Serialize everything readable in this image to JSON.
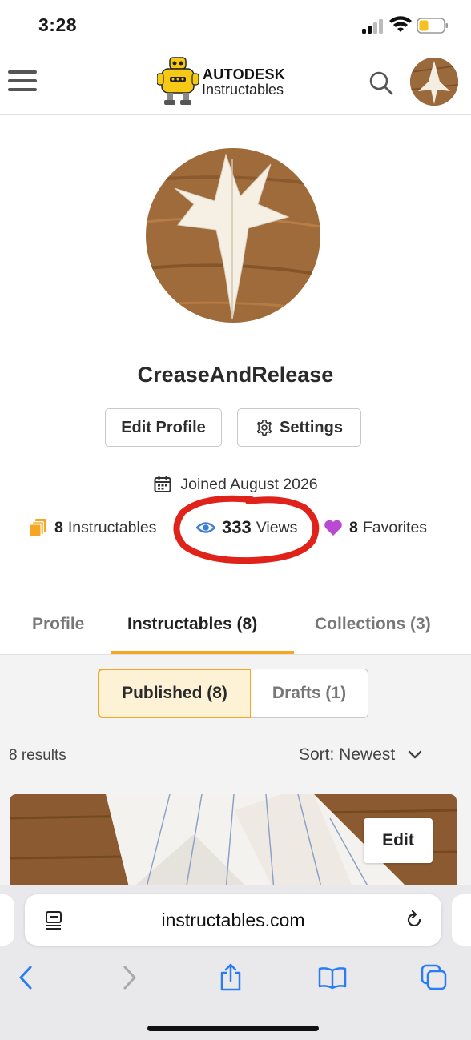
{
  "status_bar": {
    "time": "3:28"
  },
  "header": {
    "logo_brand": "AUTODESK",
    "logo_sub": "Instructables",
    "icons": [
      "hamburger-menu-icon",
      "search-icon",
      "user-avatar"
    ]
  },
  "profile": {
    "username": "CreaseAndRelease",
    "edit_profile_label": "Edit Profile",
    "settings_label": "Settings",
    "joined": "Joined August 2026",
    "stats": {
      "instructables_count": "8",
      "instructables_label": "Instructables",
      "views_count": "333",
      "views_label": "Views",
      "favorites_count": "8",
      "favorites_label": "Favorites"
    }
  },
  "tabs": [
    {
      "label": "Profile",
      "active": false
    },
    {
      "label": "Instructables (8)",
      "active": true
    },
    {
      "label": "Collections (3)",
      "active": false
    }
  ],
  "filters": {
    "published_label": "Published (8)",
    "drafts_label": "Drafts (1)"
  },
  "results": {
    "count_text": "8 results",
    "sort_label": "Sort: Newest"
  },
  "card": {
    "edit_label": "Edit"
  },
  "browser": {
    "url": "instructables.com"
  },
  "colors": {
    "accent": "#f5a623",
    "views_icon": "#3d7fd6",
    "favorites_icon": "#b84bd1",
    "annotation": "#e0231a"
  }
}
